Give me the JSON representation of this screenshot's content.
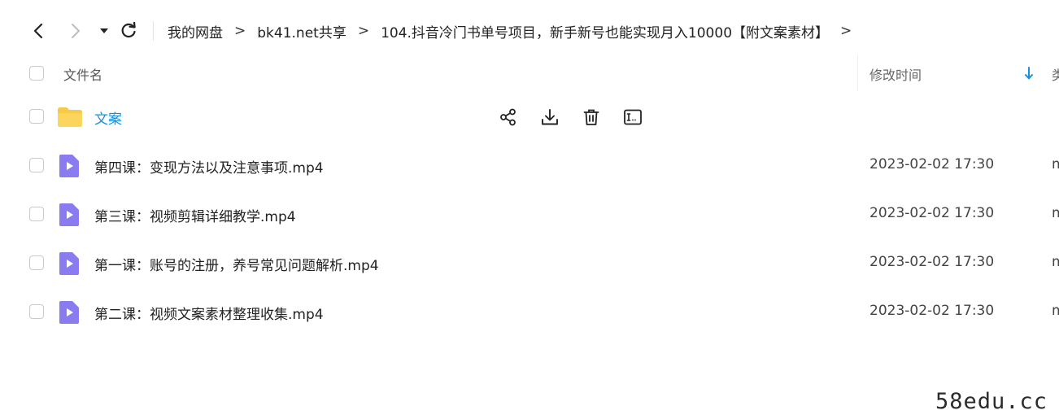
{
  "breadcrumb": {
    "items": [
      "我的网盘",
      "bk41.net共享",
      "104.抖音冷门书单号项目，新手新号也能实现月入10000【附文案素材】"
    ],
    "separator": ">"
  },
  "columns": {
    "name": "文件名",
    "modified": "修改时间",
    "type": "类"
  },
  "files": [
    {
      "name": "文案",
      "kind": "folder",
      "time": "",
      "type": ""
    },
    {
      "name": "第四课：变现方法以及注意事项.mp4",
      "kind": "video",
      "time": "2023-02-02 17:30",
      "type": "m"
    },
    {
      "name": "第三课：视频剪辑详细教学.mp4",
      "kind": "video",
      "time": "2023-02-02 17:30",
      "type": "m"
    },
    {
      "name": "第一课：账号的注册，养号常见问题解析.mp4",
      "kind": "video",
      "time": "2023-02-02 17:30",
      "type": "m"
    },
    {
      "name": "第二课：视频文案素材整理收集.mp4",
      "kind": "video",
      "time": "2023-02-02 17:30",
      "type": "m"
    }
  ],
  "watermark": "58edu.cc",
  "colors": {
    "folder": "#f7c948",
    "video": "#8a7cf0",
    "link": "#1a8fdc",
    "sort_arrow": "#1a8fdc"
  },
  "icons": {
    "back": "chevron-left-icon",
    "forward": "chevron-right-icon",
    "dropdown": "caret-down-icon",
    "refresh": "refresh-icon",
    "share": "share-icon",
    "download": "download-icon",
    "delete": "trash-icon",
    "rename": "rename-icon",
    "sort": "arrow-down-icon"
  }
}
